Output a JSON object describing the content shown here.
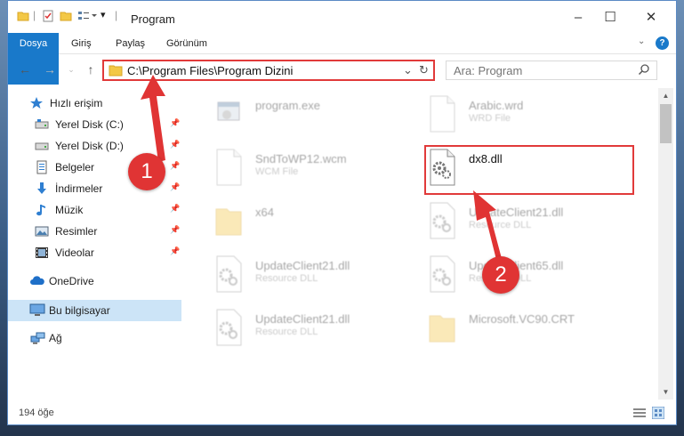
{
  "window": {
    "title": "Program",
    "controls": {
      "minimize": "–",
      "maximize": "☐",
      "close": "✕"
    }
  },
  "ribbon": {
    "tabs": [
      {
        "label": "Dosya"
      },
      {
        "label": "Giriş"
      },
      {
        "label": "Paylaş"
      },
      {
        "label": "Görünüm"
      }
    ]
  },
  "navigation": {
    "address": "C:\\Program Files\\Program Dizini",
    "search_placeholder": "Ara: Program"
  },
  "sidebar": {
    "quick_access": "Hızlı erişim",
    "items": [
      {
        "label": "Yerel Disk (C:)",
        "icon": "drive-icon",
        "pinned": true
      },
      {
        "label": "Yerel Disk (D:)",
        "icon": "drive-icon",
        "pinned": true
      },
      {
        "label": "Belgeler",
        "icon": "documents-icon",
        "pinned": true
      },
      {
        "label": "İndirmeler",
        "icon": "downloads-icon",
        "pinned": true
      },
      {
        "label": "Müzik",
        "icon": "music-icon",
        "pinned": true
      },
      {
        "label": "Resimler",
        "icon": "pictures-icon",
        "pinned": true
      },
      {
        "label": "Videolar",
        "icon": "videos-icon",
        "pinned": true
      }
    ],
    "onedrive": "OneDrive",
    "this_pc": "Bu bilgisayar",
    "network": "Ağ"
  },
  "files": [
    {
      "name": "program.exe",
      "subtitle": "",
      "icon": "exe-icon",
      "highlighted": false
    },
    {
      "name": "Arabic.wrd",
      "subtitle": "WRD File",
      "icon": "document-icon",
      "highlighted": false
    },
    {
      "name": "SndToWP12.wcm",
      "subtitle": "WCM File",
      "icon": "document-icon",
      "highlighted": false
    },
    {
      "name": "dx8.dll",
      "subtitle": "",
      "icon": "dll-gear-icon",
      "highlighted": true
    },
    {
      "name": "x64",
      "subtitle": "",
      "icon": "folder-icon",
      "highlighted": false
    },
    {
      "name": "UpdateClient21.dll",
      "subtitle": "Resource DLL",
      "icon": "dll-gear-icon",
      "highlighted": false
    },
    {
      "name": "UpdateClient21.dll",
      "subtitle": "Resource DLL",
      "icon": "dll-gear-icon",
      "highlighted": false
    },
    {
      "name": "UpdateClient65.dll",
      "subtitle": "Resource DLL",
      "icon": "dll-gear-icon",
      "highlighted": false
    },
    {
      "name": "UpdateClient21.dll",
      "subtitle": "Resource DLL",
      "icon": "dll-gear-icon",
      "highlighted": false
    },
    {
      "name": "Microsoft.VC90.CRT",
      "subtitle": "",
      "icon": "folder-icon",
      "highlighted": false
    }
  ],
  "status": {
    "item_count": "194 öğe"
  },
  "annotations": [
    {
      "number": "1",
      "target": "address-bar"
    },
    {
      "number": "2",
      "target": "dx8.dll"
    }
  ],
  "colors": {
    "accent": "#1979ca",
    "annotation": "#e03434",
    "selection": "#cce4f7",
    "folder": "#f3c846"
  }
}
